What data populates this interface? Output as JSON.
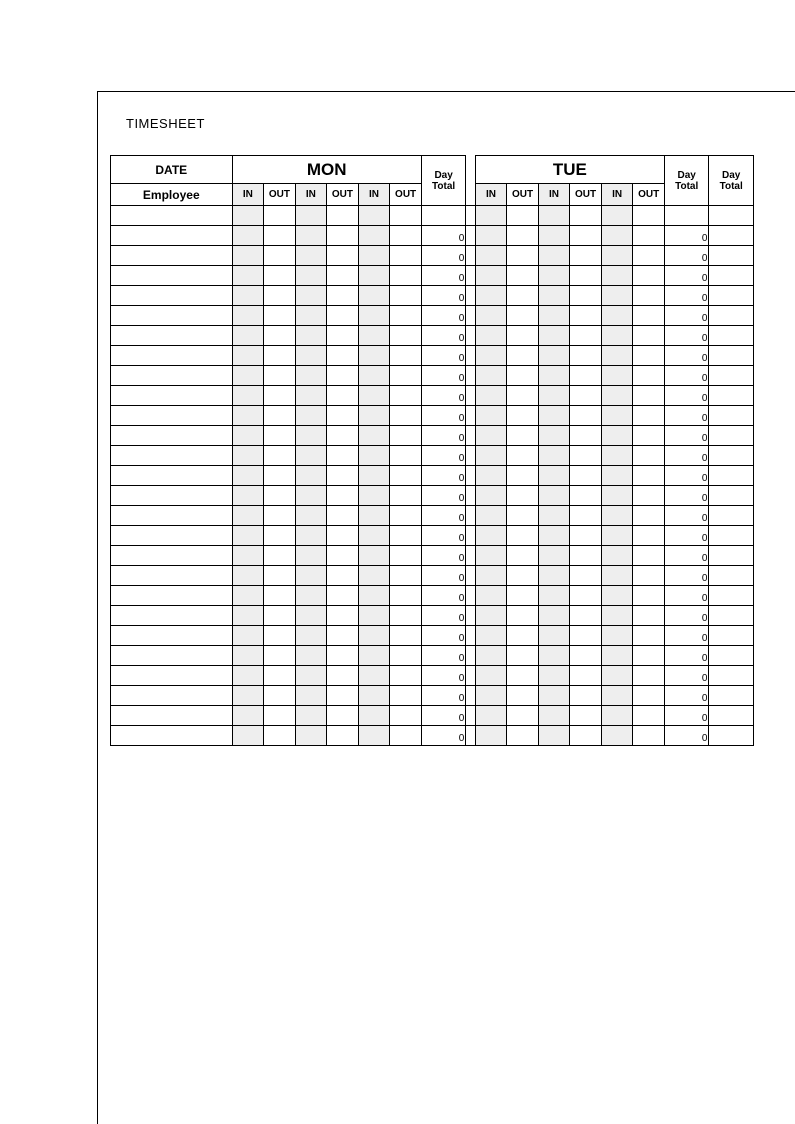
{
  "title": "TIMESHEET",
  "header": {
    "date": "DATE",
    "mon": "MON",
    "tue": "TUE",
    "day_total": "Day\nTotal",
    "employee": "Employee",
    "in": "IN",
    "out": "OUT"
  },
  "rows": [
    {
      "mon_total": 0,
      "tue_total": 0
    },
    {
      "mon_total": 0,
      "tue_total": 0
    },
    {
      "mon_total": 0,
      "tue_total": 0
    },
    {
      "mon_total": 0,
      "tue_total": 0
    },
    {
      "mon_total": 0,
      "tue_total": 0
    },
    {
      "mon_total": 0,
      "tue_total": 0
    },
    {
      "mon_total": 0,
      "tue_total": 0
    },
    {
      "mon_total": 0,
      "tue_total": 0
    },
    {
      "mon_total": 0,
      "tue_total": 0
    },
    {
      "mon_total": 0,
      "tue_total": 0
    },
    {
      "mon_total": 0,
      "tue_total": 0
    },
    {
      "mon_total": 0,
      "tue_total": 0
    },
    {
      "mon_total": 0,
      "tue_total": 0
    },
    {
      "mon_total": 0,
      "tue_total": 0
    },
    {
      "mon_total": 0,
      "tue_total": 0
    },
    {
      "mon_total": 0,
      "tue_total": 0
    },
    {
      "mon_total": 0,
      "tue_total": 0
    },
    {
      "mon_total": 0,
      "tue_total": 0
    },
    {
      "mon_total": 0,
      "tue_total": 0
    },
    {
      "mon_total": 0,
      "tue_total": 0
    },
    {
      "mon_total": 0,
      "tue_total": 0
    },
    {
      "mon_total": 0,
      "tue_total": 0
    },
    {
      "mon_total": 0,
      "tue_total": 0
    },
    {
      "mon_total": 0,
      "tue_total": 0
    },
    {
      "mon_total": 0,
      "tue_total": 0
    },
    {
      "mon_total": 0,
      "tue_total": 0
    }
  ]
}
